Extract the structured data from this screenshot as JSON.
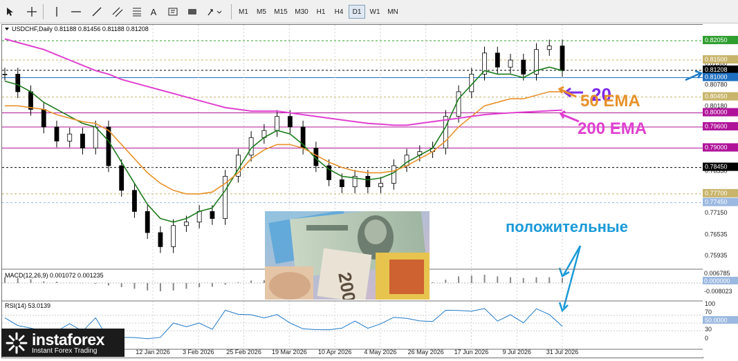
{
  "toolbar": {
    "timeframes": [
      "M1",
      "M5",
      "M15",
      "M30",
      "H1",
      "H4",
      "D1",
      "W1",
      "MN"
    ],
    "active_timeframe": "D1",
    "tools": [
      "cursor-icon",
      "crosshair-icon",
      "vertical-line-icon",
      "horizontal-line-icon",
      "trendline-icon",
      "channel-icon",
      "fibonacci-icon",
      "text-icon",
      "label-icon",
      "shapes-icon",
      "arrows-icon"
    ],
    "text_tool_label": "A"
  },
  "main_chart": {
    "header": "USDCHF,Daily  0.81188 0.81456 0.81188 0.81208",
    "current_price": "0.81208"
  },
  "annotations": {
    "ema20": "20",
    "ema50": "50 EMA",
    "ema200": "200 EMA",
    "positive": "положительные",
    "color_ema20": "#7d2ae8",
    "color_ema50": "#e8912a",
    "color_ema200": "#e040d0",
    "color_positive": "#1a9ad8"
  },
  "macd": {
    "header": "MACD(12,26,9) 0.001072 0.001235",
    "levels": [
      "0.006785",
      "0.000000",
      "-0.008023"
    ]
  },
  "rsi": {
    "header": "RSI(14) 53.0139",
    "levels": [
      "100",
      "70",
      "50.0000",
      "30",
      "0"
    ]
  },
  "logo": {
    "brand": "instaforex",
    "tagline": "Instant Forex Trading"
  },
  "chart_data": {
    "type": "line",
    "instrument": "USDCHF",
    "period": "Daily",
    "x_ticks": [
      "12 Jan 2026",
      "3 Feb 2026",
      "25 Feb 2026",
      "19 Mar 2026",
      "10 Apr 2026",
      "4 May 2026",
      "26 May 2026",
      "17 Jun 2026",
      "9 Jul 2026",
      "31 Jul 2026"
    ],
    "y_ticks": [
      "0.82050",
      "0.81500",
      "0.81380",
      "0.81208",
      "0.81000",
      "0.80780",
      "0.80450",
      "0.80180",
      "0.80000",
      "0.79600",
      "0.79000",
      "0.78450",
      "0.78330",
      "0.77700",
      "0.77450",
      "0.77150",
      "0.76535",
      "0.75935"
    ],
    "highlighted_levels": [
      {
        "value": "0.82050",
        "color": "#2e9e2e"
      },
      {
        "value": "0.81500",
        "color": "#c8b46a"
      },
      {
        "value": "0.81208",
        "color": "#000000"
      },
      {
        "value": "0.81000",
        "color": "#1f6fc0"
      },
      {
        "value": "0.80450",
        "color": "#c8b46a"
      },
      {
        "value": "0.80000",
        "color": "#b0139a"
      },
      {
        "value": "0.79600",
        "color": "#b0139a"
      },
      {
        "value": "0.79000",
        "color": "#b0139a"
      },
      {
        "value": "0.78450",
        "color": "#000000"
      },
      {
        "value": "0.77700",
        "color": "#c8b46a"
      },
      {
        "value": "0.77450",
        "color": "#9ab8e0"
      }
    ],
    "ylim": [
      0.756,
      0.825
    ],
    "series": [
      {
        "name": "Close",
        "color": "#000000",
        "values": [
          0.811,
          0.806,
          0.801,
          0.796,
          0.792,
          0.794,
          0.79,
          0.796,
          0.785,
          0.778,
          0.772,
          0.766,
          0.762,
          0.768,
          0.769,
          0.772,
          0.77,
          0.782,
          0.788,
          0.793,
          0.795,
          0.799,
          0.796,
          0.79,
          0.785,
          0.781,
          0.779,
          0.782,
          0.779,
          0.78,
          0.785,
          0.788,
          0.789,
          0.79,
          0.799,
          0.806,
          0.811,
          0.817,
          0.813,
          0.815,
          0.811,
          0.818,
          0.819,
          0.812
        ]
      },
      {
        "name": "EMA20",
        "color": "#1a7a1a",
        "values": [
          0.809,
          0.808,
          0.806,
          0.803,
          0.801,
          0.799,
          0.797,
          0.796,
          0.792,
          0.786,
          0.78,
          0.774,
          0.77,
          0.769,
          0.77,
          0.772,
          0.773,
          0.778,
          0.784,
          0.79,
          0.793,
          0.795,
          0.794,
          0.791,
          0.787,
          0.784,
          0.782,
          0.7815,
          0.781,
          0.7815,
          0.783,
          0.786,
          0.788,
          0.79,
          0.796,
          0.804,
          0.808,
          0.812,
          0.811,
          0.811,
          0.81,
          0.812,
          0.813,
          0.812
        ]
      },
      {
        "name": "EMA50",
        "color": "#e8912a",
        "values": [
          0.802,
          0.802,
          0.8015,
          0.801,
          0.7995,
          0.7985,
          0.7975,
          0.797,
          0.795,
          0.791,
          0.787,
          0.783,
          0.78,
          0.778,
          0.777,
          0.777,
          0.7775,
          0.78,
          0.783,
          0.787,
          0.7895,
          0.791,
          0.791,
          0.79,
          0.788,
          0.786,
          0.7845,
          0.7835,
          0.783,
          0.783,
          0.7835,
          0.785,
          0.787,
          0.789,
          0.792,
          0.796,
          0.799,
          0.802,
          0.803,
          0.804,
          0.804,
          0.805,
          0.806,
          0.806
        ]
      },
      {
        "name": "EMA200",
        "color": "#e040d0",
        "values": [
          0.821,
          0.82,
          0.819,
          0.818,
          0.8165,
          0.815,
          0.8135,
          0.812,
          0.811,
          0.8095,
          0.8085,
          0.8075,
          0.8065,
          0.8055,
          0.8045,
          0.8035,
          0.8025,
          0.8015,
          0.801,
          0.8005,
          0.8005,
          0.8005,
          0.8,
          0.7995,
          0.799,
          0.7985,
          0.798,
          0.7975,
          0.797,
          0.7968,
          0.7965,
          0.7965,
          0.797,
          0.7975,
          0.798,
          0.7985,
          0.799,
          0.7995,
          0.7998,
          0.8,
          0.8002,
          0.8004,
          0.8006,
          0.8008
        ]
      }
    ]
  }
}
